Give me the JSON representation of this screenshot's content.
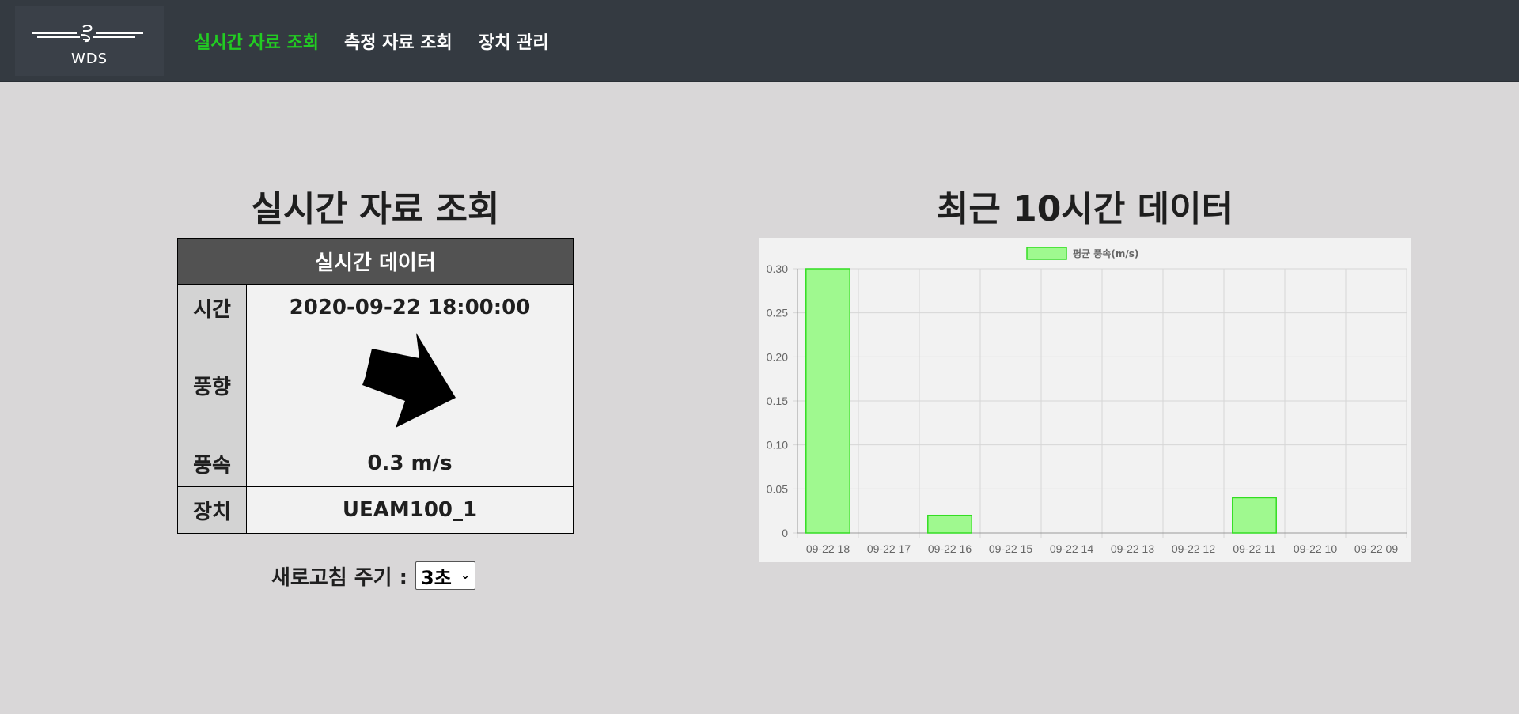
{
  "nav": {
    "logo_text": "WDS",
    "items": [
      {
        "label": "실시간 자료 조회",
        "active": true
      },
      {
        "label": "측정 자료 조회",
        "active": false
      },
      {
        "label": "장치 관리",
        "active": false
      }
    ]
  },
  "realtime": {
    "title": "실시간 자료 조회",
    "table_header": "실시간 데이터",
    "rows": {
      "time": {
        "label": "시간",
        "value": "2020-09-22 18:00:00"
      },
      "direction": {
        "label": "풍향",
        "icon": "wind-direction-arrow-icon"
      },
      "speed": {
        "label": "풍속",
        "value": "0.3 m/s"
      },
      "device": {
        "label": "장치",
        "value": "UEAM100_1"
      }
    },
    "refresh": {
      "label": "새로고침 주기 :",
      "selected": "3초"
    }
  },
  "recent": {
    "title": "최근 10시간 데이터"
  },
  "colors": {
    "nav_bg": "#343a41",
    "active_nav": "#22cc22",
    "bar_fill": "#9ff98f",
    "bar_stroke": "#33dd22"
  },
  "chart_data": {
    "type": "bar",
    "categories": [
      "09-22 18",
      "09-22 17",
      "09-22 16",
      "09-22 15",
      "09-22 14",
      "09-22 13",
      "09-22 12",
      "09-22 11",
      "09-22 10",
      "09-22 09"
    ],
    "series": [
      {
        "name": "평균 풍속(m/s)",
        "values": [
          0.3,
          0,
          0.02,
          0,
          0,
          0,
          0,
          0.04,
          0,
          0
        ]
      }
    ],
    "ylim": [
      0,
      0.3
    ],
    "yticks": [
      "0",
      "0.05",
      "0.10",
      "0.15",
      "0.20",
      "0.25",
      "0.30"
    ],
    "grid": true,
    "legend": "top-center"
  }
}
